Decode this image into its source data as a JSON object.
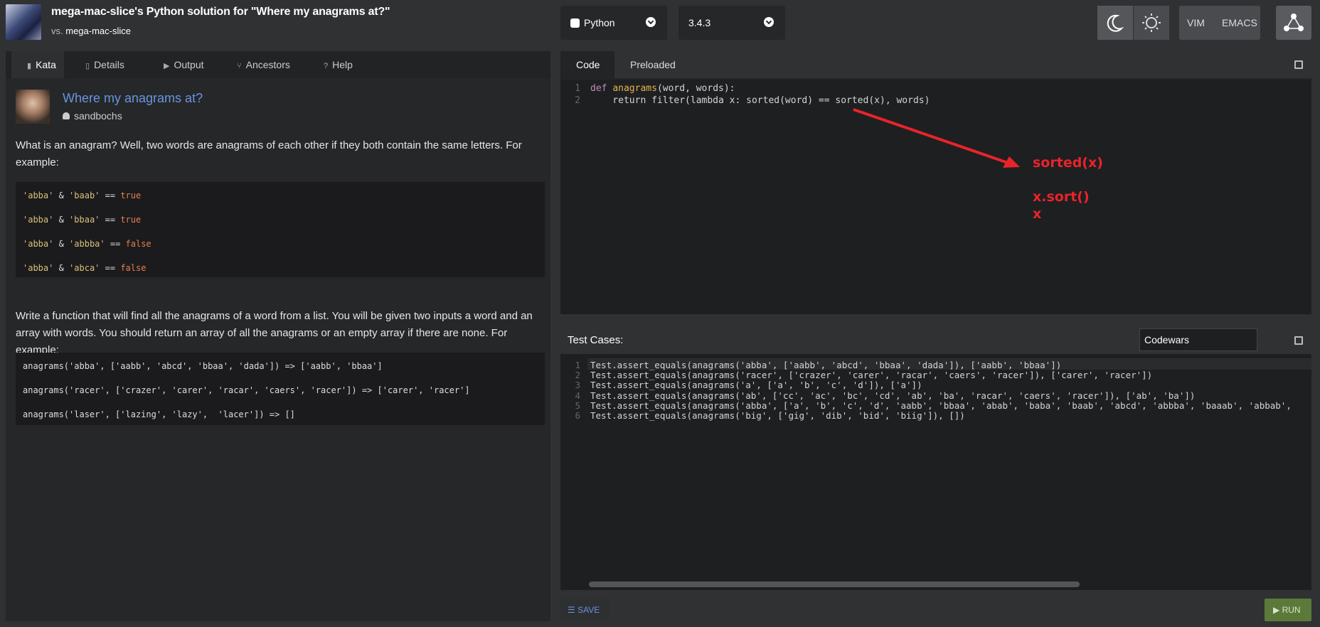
{
  "header": {
    "title": "mega-mac-slice's Python solution for \"Where my anagrams at?\"",
    "subtitle_prefix": "vs.",
    "subtitle_user": "mega-mac-slice",
    "language": "Python",
    "version": "3.4.3",
    "editor_modes": [
      "VIM",
      "EMACS"
    ]
  },
  "left": {
    "tabs": [
      "Kata",
      "Details",
      "Output",
      "Ancestors",
      "Help"
    ],
    "kata_name": "Where my anagrams at?",
    "author": "sandbochs",
    "para1": "What is an anagram? Well, two words are anagrams of each other if they both contain the same letters. For example:",
    "examples1": [
      {
        "a": "'abba'",
        "op": " & ",
        "b": "'baab'",
        "eq": " == ",
        "r": "true"
      },
      {
        "a": "'abba'",
        "op": " & ",
        "b": "'bbaa'",
        "eq": " == ",
        "r": "true"
      },
      {
        "a": "'abba'",
        "op": " & ",
        "b": "'abbba'",
        "eq": " == ",
        "r": "false"
      },
      {
        "a": "'abba'",
        "op": " & ",
        "b": "'abca'",
        "eq": " == ",
        "r": "false"
      }
    ],
    "para2": "Write a function that will find all the anagrams of a word from a list. You will be given two inputs a word and an array with words. You should return an array of all the anagrams or an empty array if there are none. For example:",
    "examples2": [
      "anagrams('abba', ['aabb', 'abcd', 'bbaa', 'dada']) => ['aabb', 'bbaa']",
      "anagrams('racer', ['crazer', 'carer', 'racar', 'caers', 'racer']) => ['carer', 'racer']",
      "anagrams('laser', ['lazing', 'lazy',  'lacer']) => []"
    ]
  },
  "code_panel": {
    "tabs": [
      "Code",
      "Preloaded"
    ],
    "line1_def": "def ",
    "line1_fn": "anagrams",
    "line1_rest": "(word, words):",
    "line2": "    return filter(lambda x: sorted(word) == sorted(x), words)",
    "annotations": [
      "sorted(x)",
      "x.sort()",
      "x"
    ]
  },
  "tests": {
    "label": "Test Cases:",
    "framework": "Codewars",
    "lines": [
      "Test.assert_equals(anagrams('abba', ['aabb', 'abcd', 'bbaa', 'dada']), ['aabb', 'bbaa'])",
      "Test.assert_equals(anagrams('racer', ['crazer', 'carer', 'racar', 'caers', 'racer']), ['carer', 'racer'])",
      "Test.assert_equals(anagrams('a', ['a', 'b', 'c', 'd']), ['a'])",
      "Test.assert_equals(anagrams('ab', ['cc', 'ac', 'bc', 'cd', 'ab', 'ba', 'racar', 'caers', 'racer']), ['ab', 'ba'])",
      "Test.assert_equals(anagrams('abba', ['a', 'b', 'c', 'd', 'aabb', 'bbaa', 'abab', 'baba', 'baab', 'abcd', 'abbba', 'baaab', 'abbab',",
      "Test.assert_equals(anagrams('big', ['gig', 'dib', 'bid', 'biig']), [])"
    ]
  },
  "actions": {
    "save": "SAVE",
    "run": "RUN"
  }
}
